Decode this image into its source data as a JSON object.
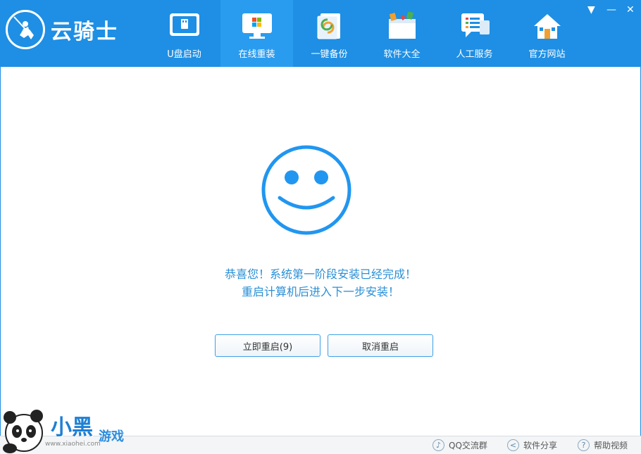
{
  "app": {
    "name": "云骑士"
  },
  "nav": [
    {
      "label": "U盘启动",
      "icon": "usb-drive-icon",
      "active": false
    },
    {
      "label": "在线重装",
      "icon": "windows-monitor-icon",
      "active": true
    },
    {
      "label": "一键备份",
      "icon": "backup-icon",
      "active": false
    },
    {
      "label": "软件大全",
      "icon": "software-box-icon",
      "active": false
    },
    {
      "label": "人工服务",
      "icon": "chat-service-icon",
      "active": false
    },
    {
      "label": "官方网站",
      "icon": "home-icon",
      "active": false
    }
  ],
  "window_controls": {
    "menu": "▼",
    "minimize": "—",
    "close": "✕"
  },
  "message": {
    "line1": "恭喜您！系统第一阶段安装已经完成！",
    "line2": "重启计算机后进入下一步安装！"
  },
  "buttons": {
    "restart": "立即重启(9)",
    "cancel": "取消重启"
  },
  "statusbar": {
    "qq_group": "QQ交流群",
    "share": "软件分享",
    "help_video": "帮助视频"
  },
  "watermark": {
    "main": "小黑",
    "sub": "游戏",
    "url": "www.xiaohei.com"
  },
  "colors": {
    "accent": "#1e8fe4",
    "active_tab": "#2a9cf0",
    "message": "#2a8fd6"
  }
}
